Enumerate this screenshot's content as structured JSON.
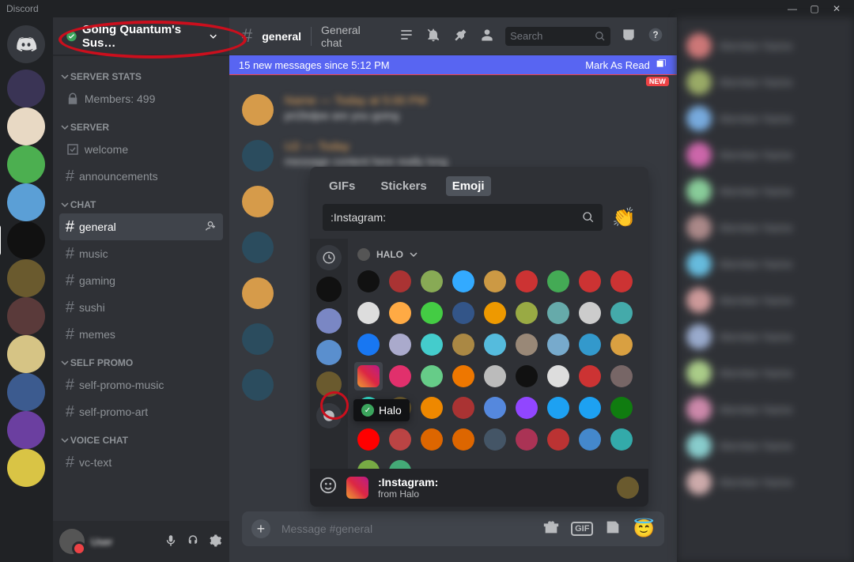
{
  "app_title": "Discord",
  "server": {
    "name": "Going Quantum's Sus…",
    "verified": true
  },
  "categories": [
    {
      "name": "SERVER STATS",
      "channels": [
        {
          "icon": "lock",
          "name": "Members: 499"
        }
      ]
    },
    {
      "name": "SERVER",
      "channels": [
        {
          "icon": "rules",
          "name": "welcome"
        },
        {
          "icon": "hash",
          "name": "announcements"
        }
      ]
    },
    {
      "name": "CHAT",
      "channels": [
        {
          "icon": "hash",
          "name": "general",
          "active": true
        },
        {
          "icon": "hash",
          "name": "music"
        },
        {
          "icon": "hash",
          "name": "gaming"
        },
        {
          "icon": "hash",
          "name": "sushi"
        },
        {
          "icon": "hash",
          "name": "memes"
        }
      ]
    },
    {
      "name": "SELF PROMO",
      "channels": [
        {
          "icon": "hash",
          "name": "self-promo-music"
        },
        {
          "icon": "hash",
          "name": "self-promo-art"
        }
      ]
    },
    {
      "name": "VOICE CHAT",
      "channels": [
        {
          "icon": "hash",
          "name": "vc-text"
        }
      ]
    }
  ],
  "user_panel": {
    "username": "User"
  },
  "channel_header": {
    "name": "general",
    "topic": "General chat",
    "search_placeholder": "Search"
  },
  "newmsg": {
    "text": "15 new messages since 5:12 PM",
    "action": "Mark As Read",
    "badge": "NEW"
  },
  "input": {
    "placeholder": "Message #general"
  },
  "picker": {
    "tabs": [
      "GIFs",
      "Stickers",
      "Emoji"
    ],
    "active_tab": "Emoji",
    "search_value": ":Instagram:",
    "server_header": "HALO",
    "tooltip": "Halo",
    "footer": {
      "name": ":Instagram:",
      "from": "from Halo"
    }
  },
  "emoji_colors": [
    "#111",
    "#a33",
    "#8a5",
    "#3af",
    "#c94",
    "#c33",
    "#4a5",
    "#c33",
    "#c33",
    "#ddd",
    "#fa4",
    "#4c4",
    "#358",
    "#e90",
    "#9a4",
    "#6aa",
    "#ccc",
    "#4aa",
    "#1877f2",
    "#aac",
    "#4cc",
    "#a84",
    "#5bd",
    "#987",
    "#7ac",
    "#39c",
    "#d9a041",
    "#da4",
    "#e1306c",
    "#6c8",
    "#e70",
    "#bbb",
    "#111",
    "#ddd",
    "#c33",
    "#766",
    "#3dc",
    "#6a5a2e",
    "#e80",
    "#a33",
    "#58d",
    "#9146ff",
    "#1da1f2",
    "#1da1f2",
    "#107c10",
    "#ff0000",
    "#b44",
    "#d60",
    "#d60",
    "#456",
    "#a35",
    "#b33",
    "#48c",
    "#3aa",
    "#7a4",
    "#4a7"
  ],
  "member_colors": [
    "#c77",
    "#9a6",
    "#7ad",
    "#c6a",
    "#8c9",
    "#a88",
    "#6bd",
    "#c99",
    "#9ac",
    "#ac8",
    "#c8a",
    "#8cc",
    "#caa"
  ]
}
